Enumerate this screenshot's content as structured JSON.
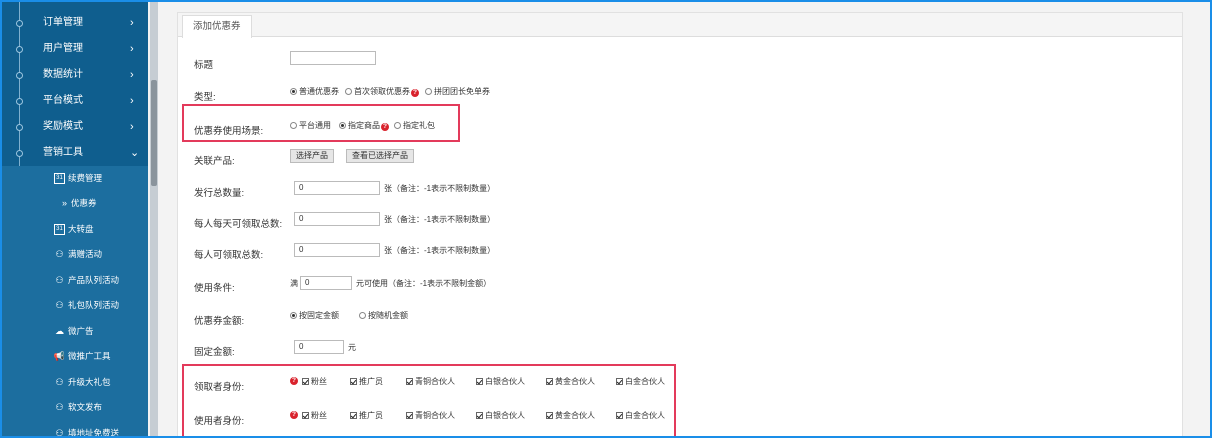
{
  "sidebar": {
    "menu": [
      {
        "label": "订单管理",
        "arrow": "›"
      },
      {
        "label": "用户管理",
        "arrow": "›"
      },
      {
        "label": "数据统计",
        "arrow": "›"
      },
      {
        "label": "平台模式",
        "arrow": "›"
      },
      {
        "label": "奖励模式",
        "arrow": "›"
      },
      {
        "label": "营销工具",
        "arrow": "⌄"
      }
    ],
    "submenu": [
      {
        "label": "续费管理",
        "icon": "calendar-icon",
        "glyph": "31"
      },
      {
        "label": "优惠券",
        "icon": "double-chevron-icon",
        "glyph": "»",
        "active": true
      },
      {
        "label": "大转盘",
        "icon": "calendar-icon",
        "glyph": "31"
      },
      {
        "label": "满赠活动",
        "icon": "users-icon",
        "glyph": "⚇"
      },
      {
        "label": "产品队列活动",
        "icon": "users-icon",
        "glyph": "⚇"
      },
      {
        "label": "礼包队列活动",
        "icon": "users-icon",
        "glyph": "⚇"
      },
      {
        "label": "微广告",
        "icon": "cloud-icon",
        "glyph": "☁"
      },
      {
        "label": "微推广工具",
        "icon": "megaphone-icon",
        "glyph": "📢"
      },
      {
        "label": "升级大礼包",
        "icon": "users-icon",
        "glyph": "⚇"
      },
      {
        "label": "软文发布",
        "icon": "users-icon",
        "glyph": "⚇"
      },
      {
        "label": "填地址免费送",
        "icon": "users-icon",
        "glyph": "⚇"
      }
    ]
  },
  "tab": {
    "label": "添加优惠券"
  },
  "form": {
    "title": {
      "label": "标题",
      "value": ""
    },
    "type": {
      "label": "类型:",
      "options": [
        "普通优惠券",
        "首次领取优惠券",
        "拼团团长免单券"
      ],
      "selected": 0
    },
    "scene": {
      "label": "优惠券使用场景:",
      "options": [
        "平台通用",
        "指定商品",
        "指定礼包"
      ],
      "selected": 1
    },
    "product": {
      "label": "关联产品:",
      "select_btn": "选择产品",
      "view_btn": "查看已选择产品"
    },
    "total": {
      "label": "发行总数量:",
      "value": "0",
      "note": "张（备注：-1表示不限制数量）"
    },
    "daily": {
      "label": "每人每天可领取总数:",
      "value": "0",
      "note": "张（备注：-1表示不限制数量）"
    },
    "per_user": {
      "label": "每人可领取总数:",
      "value": "0",
      "note": "张（备注：-1表示不限制数量）"
    },
    "condition": {
      "label": "使用条件:",
      "prefix": "满",
      "value": "0",
      "note": "元可使用（备注：-1表示不限制金额）"
    },
    "amount_type": {
      "label": "优惠券金额:",
      "options": [
        "按固定金额",
        "按随机金额"
      ],
      "selected": 0
    },
    "fixed": {
      "label": "固定金额:",
      "value": "0",
      "unit": "元"
    },
    "receiver": {
      "label": "领取者身份:",
      "roles": [
        "粉丝",
        "推广员",
        "青铜合伙人",
        "白银合伙人",
        "黄金合伙人",
        "白金合伙人"
      ]
    },
    "user": {
      "label": "使用者身份:",
      "roles": [
        "粉丝",
        "推广员",
        "青铜合伙人",
        "白银合伙人",
        "黄金合伙人",
        "白金合伙人"
      ]
    }
  },
  "help_glyph": "?",
  "colors": {
    "sidebar": "#0f5e8e",
    "submenu": "#1c6e9f",
    "highlight": "#e33a5b",
    "help": "#d9232d"
  }
}
